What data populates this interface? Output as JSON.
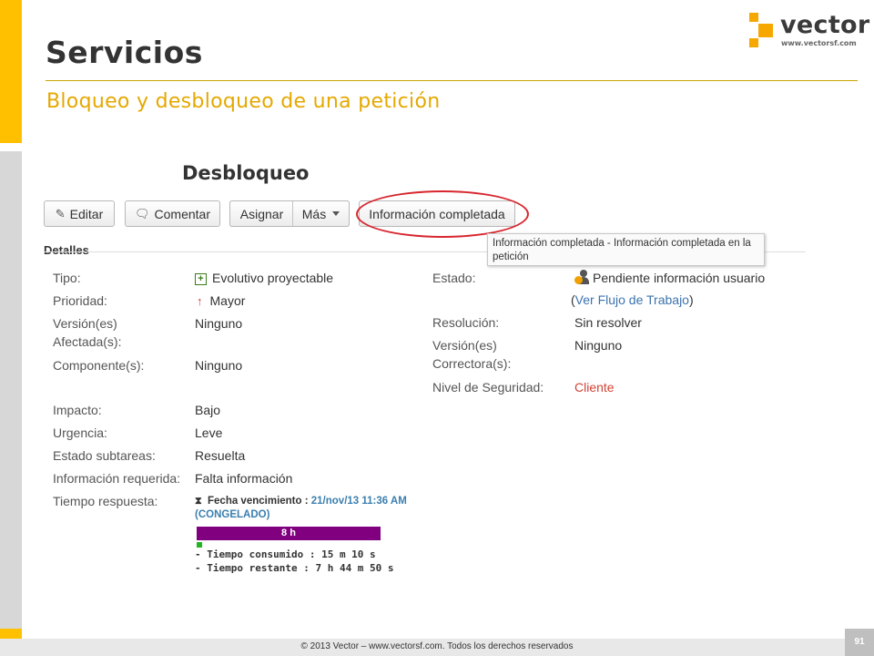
{
  "slide": {
    "title": "Servicios",
    "subtitle": "Bloqueo y desbloqueo de una petición",
    "section_heading": "Desbloqueo",
    "footer": "© 2013 Vector – www.vectorsf.com. Todos los derechos reservados",
    "page_number": "91"
  },
  "logo": {
    "name": "vector",
    "url": "www.vectorsf.com"
  },
  "toolbar": {
    "edit_label": "Editar",
    "comment_label": "Comentar",
    "assign_label": "Asignar",
    "more_label": "Más",
    "info_complete_label": "Información completada"
  },
  "tooltip": {
    "text": "Información completada - Información completada en la petición"
  },
  "details": {
    "title": "Detalles",
    "left_labels": {
      "tipo": "Tipo:",
      "prioridad": "Prioridad:",
      "version_afectada_1": "Versión(es)",
      "version_afectada_2": "Afectada(s):",
      "componente": "Componente(s):",
      "impacto": "Impacto:",
      "urgencia": "Urgencia:",
      "estado_subtareas": "Estado subtareas:",
      "info_requerida": "Información requerida:",
      "tiempo_respuesta": "Tiempo respuesta:"
    },
    "left_values": {
      "tipo": "Evolutivo proyectable",
      "prioridad": "Mayor",
      "version_afectada": "Ninguno",
      "componente": "Ninguno",
      "impacto": "Bajo",
      "urgencia": "Leve",
      "estado_subtareas": "Resuelta",
      "info_requerida": "Falta información"
    },
    "right_labels": {
      "estado": "Estado:",
      "resolucion": "Resolución:",
      "version_correctora_1": "Versión(es)",
      "version_correctora_2": "Correctora(s):",
      "nivel_seguridad": "Nivel de Seguridad:"
    },
    "right_values": {
      "estado": "Pendiente información usuario",
      "workflow_open": "(",
      "workflow_link": "Ver Flujo de Trabajo",
      "workflow_close": ")",
      "resolucion": "Sin resolver",
      "version_correctora": "Ninguno",
      "nivel_seguridad": "Cliente"
    },
    "colors": {
      "link": "#3b73af",
      "security": "#d04437"
    }
  },
  "sla": {
    "due_label": "Fecha vencimiento :",
    "due_date": "21/nov/13",
    "due_time": "11:36 AM",
    "status": "(CONGELADO)",
    "bar_label": "8 h",
    "bar_color": "#800080",
    "progress_color": "#21b521",
    "progress_fraction": 0.03,
    "consumed": "- Tiempo consumido : 15 m 10 s",
    "remaining": "- Tiempo restante : 7 h 44 m 50 s"
  },
  "theme": {
    "accent": "#ffc000",
    "subtitle_color": "#e5a800",
    "annotation_color": "#d7262e"
  }
}
